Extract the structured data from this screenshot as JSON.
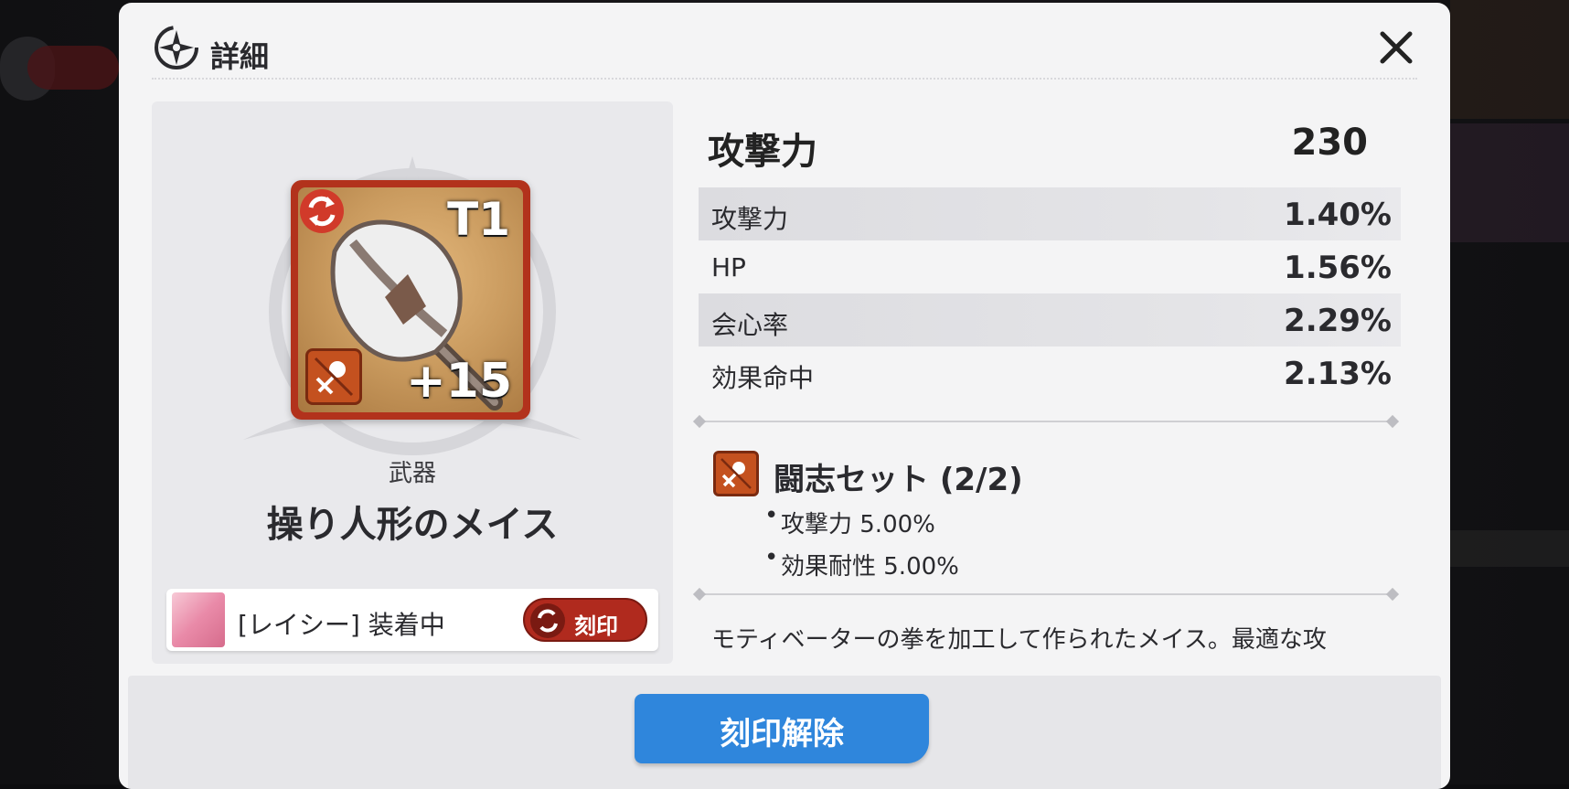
{
  "header": {
    "title": "詳細"
  },
  "item": {
    "tier": "T1",
    "enhance": "+15",
    "type": "武器",
    "name": "操り人形のメイス",
    "equip_status": "[レイシー] 装着中",
    "imprint_label": "刻印"
  },
  "stats": {
    "main": {
      "name": "攻撃力",
      "value": "230"
    },
    "subs": [
      {
        "name": "攻撃力",
        "value": "1.40%"
      },
      {
        "name": "HP",
        "value": "1.56%"
      },
      {
        "name": "会心率",
        "value": "2.29%"
      },
      {
        "name": "効果命中",
        "value": "2.13%"
      }
    ]
  },
  "set": {
    "title": "闘志セット (2/2)",
    "bonuses": [
      "攻撃力 5.00%",
      "効果耐性 5.00%"
    ]
  },
  "description": "モティベーターの拳を加工して作られたメイス。最適な攻",
  "footer": {
    "release_label": "刻印解除"
  },
  "colors": {
    "accent_blue": "#2f86dc",
    "item_frame": "#b2321c",
    "set_orange": "#c4511f"
  }
}
